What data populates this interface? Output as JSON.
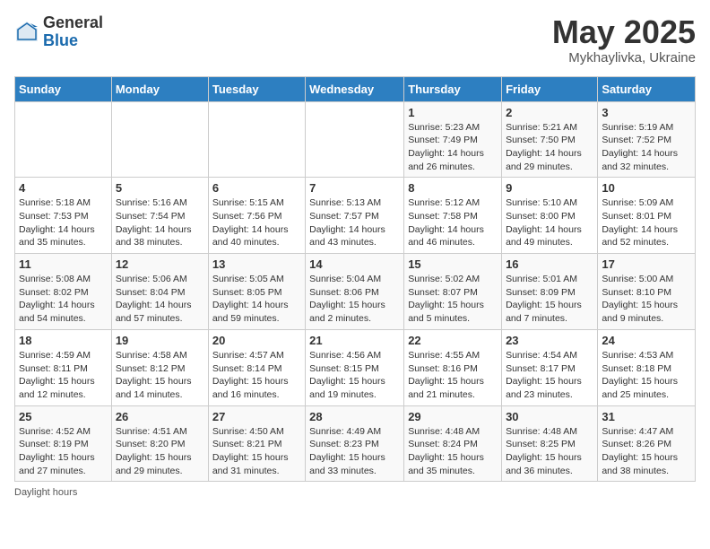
{
  "header": {
    "logo_general": "General",
    "logo_blue": "Blue",
    "month_title": "May 2025",
    "subtitle": "Mykhaylivka, Ukraine"
  },
  "days_of_week": [
    "Sunday",
    "Monday",
    "Tuesday",
    "Wednesday",
    "Thursday",
    "Friday",
    "Saturday"
  ],
  "footer_text": "Daylight hours",
  "weeks": [
    [
      {
        "day": "",
        "sunrise": "",
        "sunset": "",
        "daylight": ""
      },
      {
        "day": "",
        "sunrise": "",
        "sunset": "",
        "daylight": ""
      },
      {
        "day": "",
        "sunrise": "",
        "sunset": "",
        "daylight": ""
      },
      {
        "day": "",
        "sunrise": "",
        "sunset": "",
        "daylight": ""
      },
      {
        "day": "1",
        "sunrise": "5:23 AM",
        "sunset": "7:49 PM",
        "daylight": "14 hours and 26 minutes."
      },
      {
        "day": "2",
        "sunrise": "5:21 AM",
        "sunset": "7:50 PM",
        "daylight": "14 hours and 29 minutes."
      },
      {
        "day": "3",
        "sunrise": "5:19 AM",
        "sunset": "7:52 PM",
        "daylight": "14 hours and 32 minutes."
      }
    ],
    [
      {
        "day": "4",
        "sunrise": "5:18 AM",
        "sunset": "7:53 PM",
        "daylight": "14 hours and 35 minutes."
      },
      {
        "day": "5",
        "sunrise": "5:16 AM",
        "sunset": "7:54 PM",
        "daylight": "14 hours and 38 minutes."
      },
      {
        "day": "6",
        "sunrise": "5:15 AM",
        "sunset": "7:56 PM",
        "daylight": "14 hours and 40 minutes."
      },
      {
        "day": "7",
        "sunrise": "5:13 AM",
        "sunset": "7:57 PM",
        "daylight": "14 hours and 43 minutes."
      },
      {
        "day": "8",
        "sunrise": "5:12 AM",
        "sunset": "7:58 PM",
        "daylight": "14 hours and 46 minutes."
      },
      {
        "day": "9",
        "sunrise": "5:10 AM",
        "sunset": "8:00 PM",
        "daylight": "14 hours and 49 minutes."
      },
      {
        "day": "10",
        "sunrise": "5:09 AM",
        "sunset": "8:01 PM",
        "daylight": "14 hours and 52 minutes."
      }
    ],
    [
      {
        "day": "11",
        "sunrise": "5:08 AM",
        "sunset": "8:02 PM",
        "daylight": "14 hours and 54 minutes."
      },
      {
        "day": "12",
        "sunrise": "5:06 AM",
        "sunset": "8:04 PM",
        "daylight": "14 hours and 57 minutes."
      },
      {
        "day": "13",
        "sunrise": "5:05 AM",
        "sunset": "8:05 PM",
        "daylight": "14 hours and 59 minutes."
      },
      {
        "day": "14",
        "sunrise": "5:04 AM",
        "sunset": "8:06 PM",
        "daylight": "15 hours and 2 minutes."
      },
      {
        "day": "15",
        "sunrise": "5:02 AM",
        "sunset": "8:07 PM",
        "daylight": "15 hours and 5 minutes."
      },
      {
        "day": "16",
        "sunrise": "5:01 AM",
        "sunset": "8:09 PM",
        "daylight": "15 hours and 7 minutes."
      },
      {
        "day": "17",
        "sunrise": "5:00 AM",
        "sunset": "8:10 PM",
        "daylight": "15 hours and 9 minutes."
      }
    ],
    [
      {
        "day": "18",
        "sunrise": "4:59 AM",
        "sunset": "8:11 PM",
        "daylight": "15 hours and 12 minutes."
      },
      {
        "day": "19",
        "sunrise": "4:58 AM",
        "sunset": "8:12 PM",
        "daylight": "15 hours and 14 minutes."
      },
      {
        "day": "20",
        "sunrise": "4:57 AM",
        "sunset": "8:14 PM",
        "daylight": "15 hours and 16 minutes."
      },
      {
        "day": "21",
        "sunrise": "4:56 AM",
        "sunset": "8:15 PM",
        "daylight": "15 hours and 19 minutes."
      },
      {
        "day": "22",
        "sunrise": "4:55 AM",
        "sunset": "8:16 PM",
        "daylight": "15 hours and 21 minutes."
      },
      {
        "day": "23",
        "sunrise": "4:54 AM",
        "sunset": "8:17 PM",
        "daylight": "15 hours and 23 minutes."
      },
      {
        "day": "24",
        "sunrise": "4:53 AM",
        "sunset": "8:18 PM",
        "daylight": "15 hours and 25 minutes."
      }
    ],
    [
      {
        "day": "25",
        "sunrise": "4:52 AM",
        "sunset": "8:19 PM",
        "daylight": "15 hours and 27 minutes."
      },
      {
        "day": "26",
        "sunrise": "4:51 AM",
        "sunset": "8:20 PM",
        "daylight": "15 hours and 29 minutes."
      },
      {
        "day": "27",
        "sunrise": "4:50 AM",
        "sunset": "8:21 PM",
        "daylight": "15 hours and 31 minutes."
      },
      {
        "day": "28",
        "sunrise": "4:49 AM",
        "sunset": "8:23 PM",
        "daylight": "15 hours and 33 minutes."
      },
      {
        "day": "29",
        "sunrise": "4:48 AM",
        "sunset": "8:24 PM",
        "daylight": "15 hours and 35 minutes."
      },
      {
        "day": "30",
        "sunrise": "4:48 AM",
        "sunset": "8:25 PM",
        "daylight": "15 hours and 36 minutes."
      },
      {
        "day": "31",
        "sunrise": "4:47 AM",
        "sunset": "8:26 PM",
        "daylight": "15 hours and 38 minutes."
      }
    ]
  ]
}
